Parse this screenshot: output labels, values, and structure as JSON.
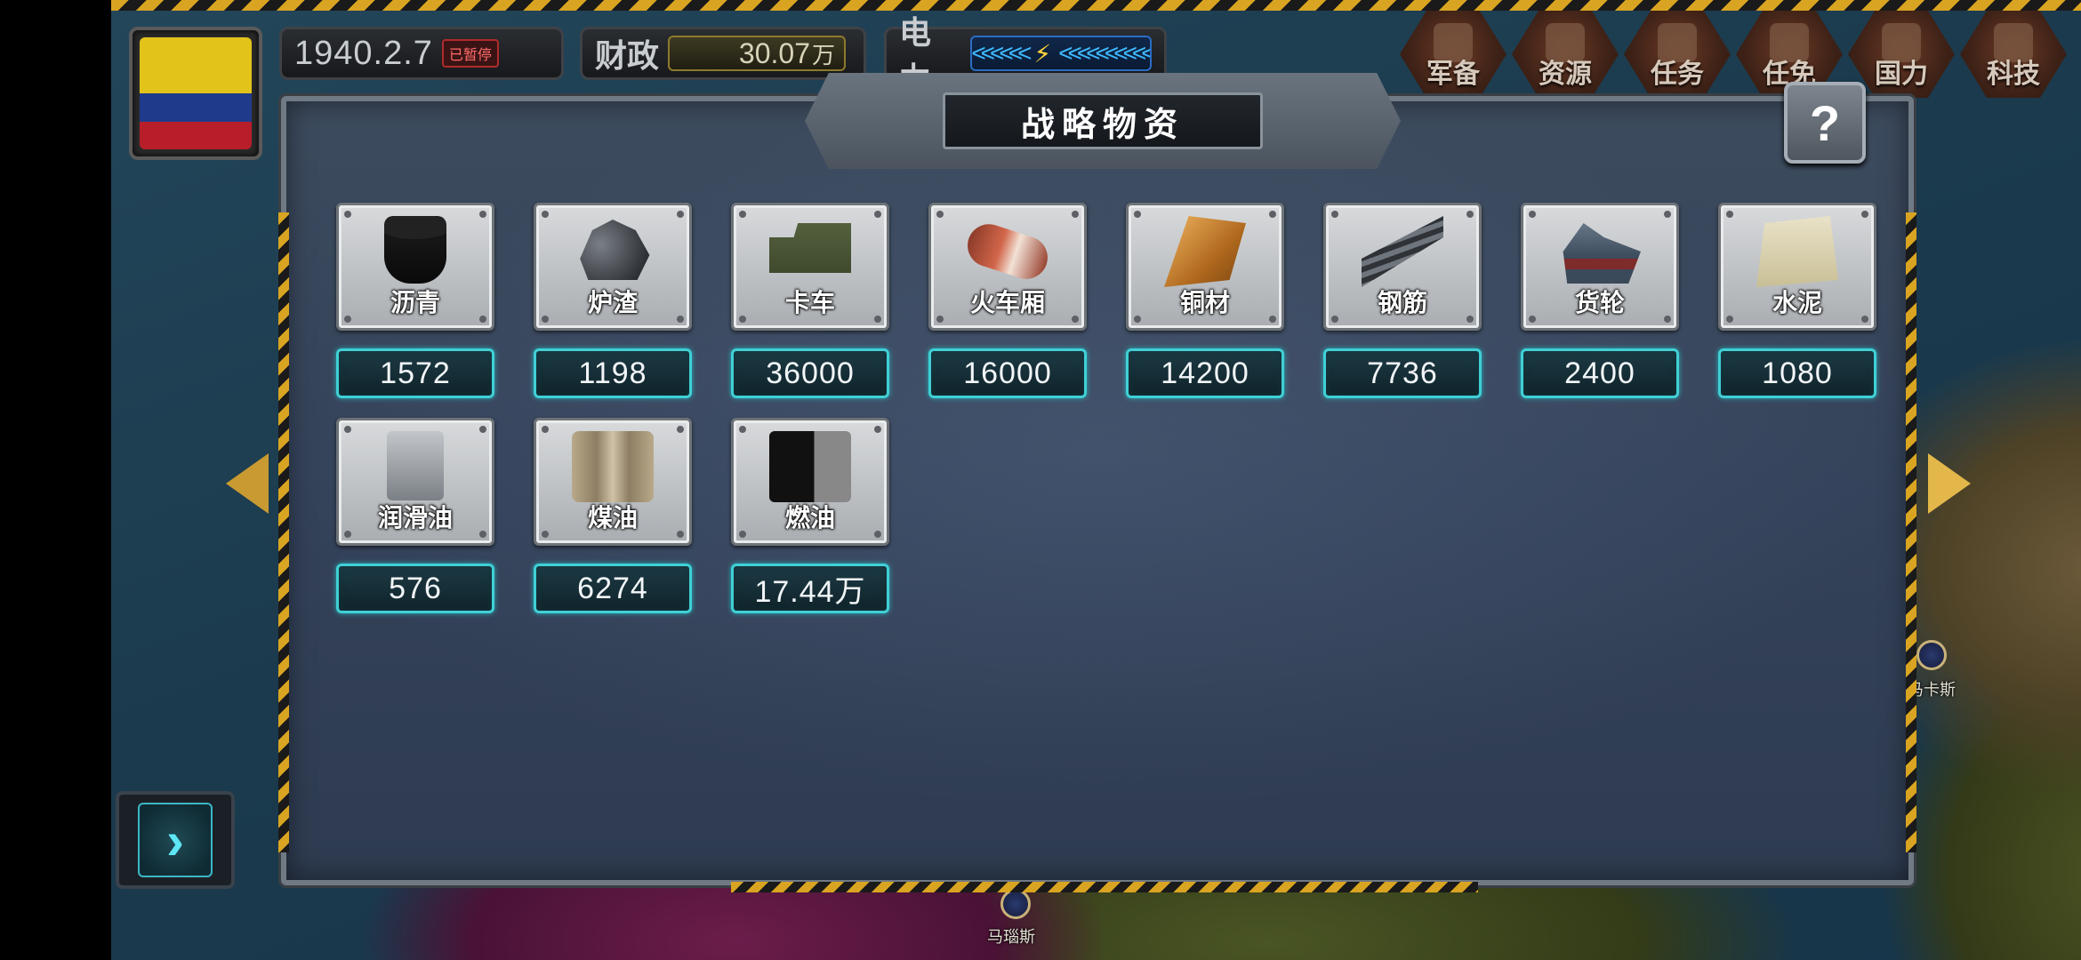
{
  "hud": {
    "date": "1940.2.7",
    "paused": "已暂停",
    "finance_label": "财政",
    "finance_value": "30.07",
    "finance_unit": "万",
    "power_label": "电力",
    "power_left": "<<<<<<",
    "power_right": "<<<<<<<<<<"
  },
  "menu": [
    {
      "label": "军备",
      "icon": "armament-icon"
    },
    {
      "label": "资源",
      "icon": "resources-icon"
    },
    {
      "label": "任务",
      "icon": "tasks-icon"
    },
    {
      "label": "任免",
      "icon": "appointment-icon"
    },
    {
      "label": "国力",
      "icon": "national-power-icon"
    },
    {
      "label": "科技",
      "icon": "technology-icon"
    }
  ],
  "panel": {
    "title": "战略物资",
    "help": "?"
  },
  "resources": [
    {
      "name": "沥青",
      "value": "1572"
    },
    {
      "name": "炉渣",
      "value": "1198"
    },
    {
      "name": "卡车",
      "value": "36000"
    },
    {
      "name": "火车厢",
      "value": "16000"
    },
    {
      "name": "铜材",
      "value": "14200"
    },
    {
      "name": "钢筋",
      "value": "7736"
    },
    {
      "name": "货轮",
      "value": "2400"
    },
    {
      "name": "水泥",
      "value": "1080"
    },
    {
      "name": "润滑油",
      "value": "576"
    },
    {
      "name": "煤油",
      "value": "6274"
    },
    {
      "name": "燃油",
      "value": "17.44万"
    }
  ],
  "map": {
    "city_right": "马卡斯",
    "city_bottom": "马瑙斯"
  },
  "colors": {
    "accent_cyan": "#3fd0d6",
    "hazard_yellow": "#d9a421",
    "flag_yellow": "#e2c31a",
    "flag_blue": "#1f3a8a",
    "flag_red": "#b81e2a"
  }
}
